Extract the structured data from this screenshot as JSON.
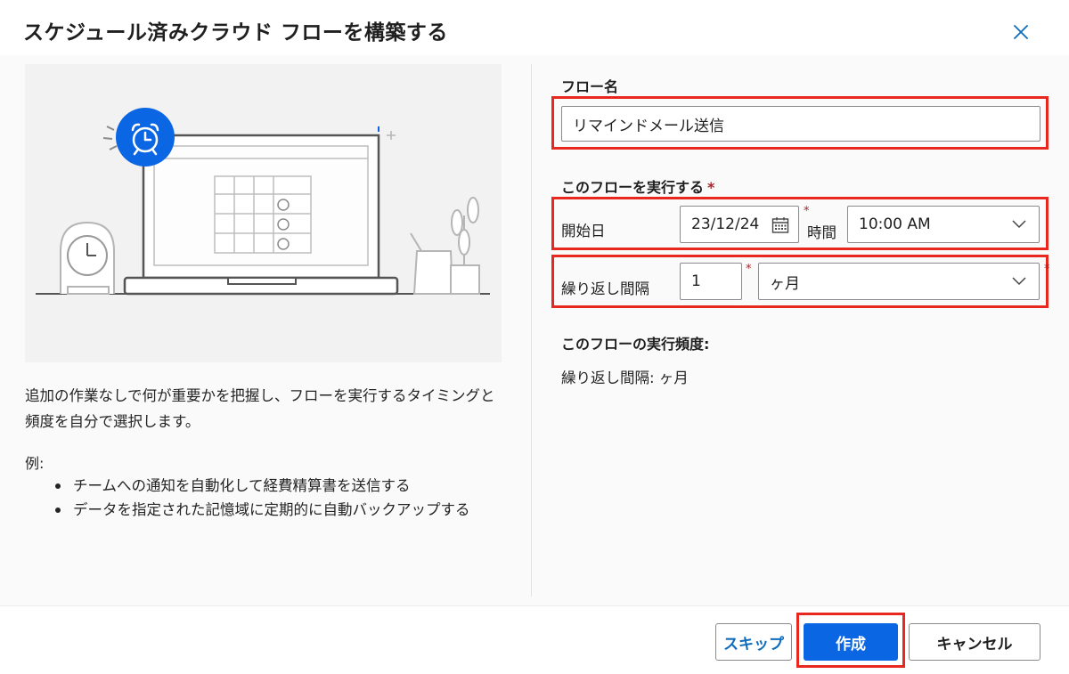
{
  "dialog": {
    "title": "スケジュール済みクラウド フローを構築する"
  },
  "left": {
    "description": "追加の作業なしで何が重要かを把握し、フローを実行するタイミングと頻度を自分で選択します。",
    "example_label": "例:",
    "examples": [
      "チームへの通知を自動化して経費精算書を送信する",
      "データを指定された記憶域に定期的に自動バックアップする"
    ]
  },
  "form": {
    "flow_name_label": "フロー名",
    "flow_name_value": "リマインドメール送信",
    "run_label": "このフローを実行する",
    "required_mark": "*",
    "start_date_label": "開始日",
    "start_date_value": "23/12/24",
    "time_label": "時間",
    "time_value": "10:00 AM",
    "repeat_label": "繰り返し間隔",
    "repeat_value": "1",
    "repeat_unit": "ヶ月",
    "summary_title": "このフローの実行頻度:",
    "summary_text": "繰り返し間隔: ヶ月"
  },
  "footer": {
    "skip_label": "スキップ",
    "create_label": "作成",
    "cancel_label": "キャンセル"
  },
  "colors": {
    "accent": "#0b66e4",
    "highlight": "#e8271f",
    "required": "#a4262c"
  },
  "icons": {
    "close": "close-icon",
    "calendar": "calendar-icon",
    "chevron": "chevron-down-icon",
    "alarm": "alarm-clock-icon"
  }
}
